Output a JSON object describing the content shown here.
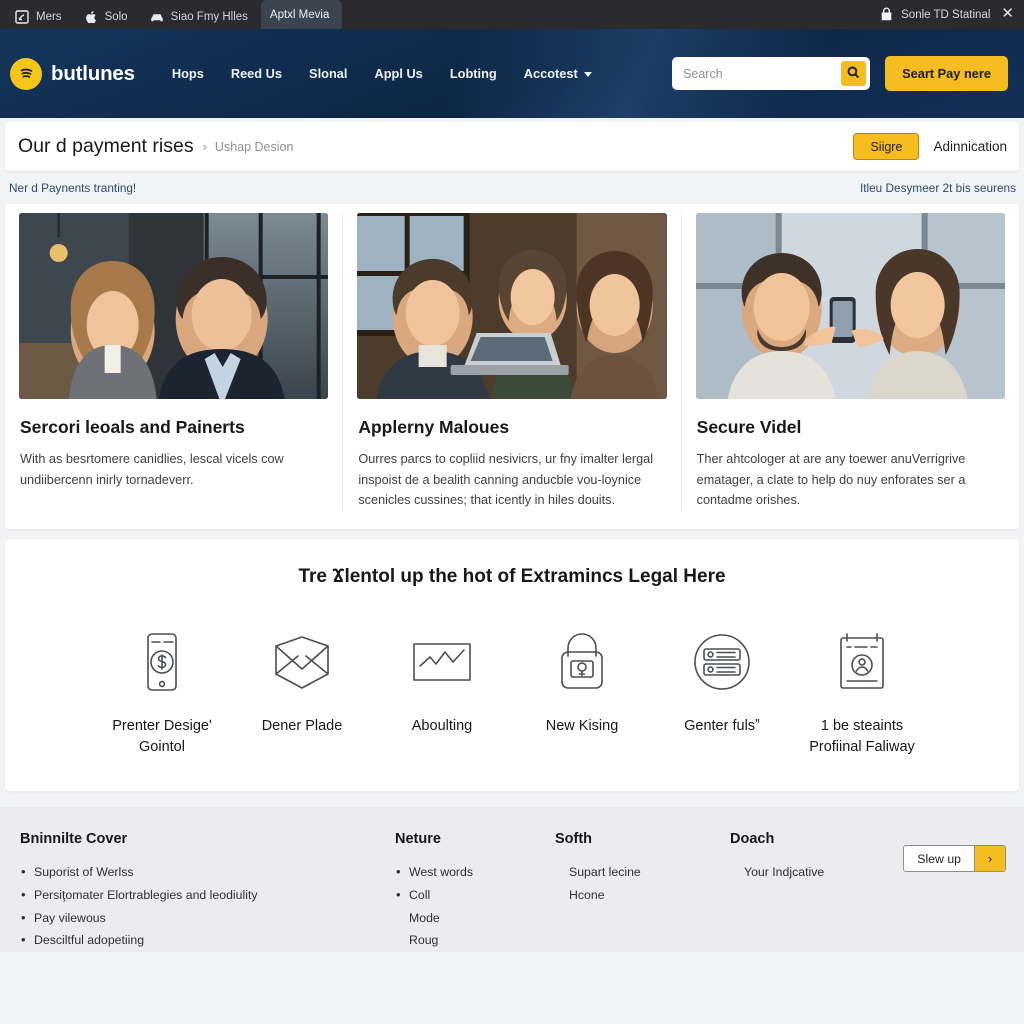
{
  "browser": {
    "tabs": [
      {
        "label": "Mers",
        "icon": "boxed-document-icon",
        "active": false
      },
      {
        "label": "Solo",
        "icon": "apple-icon",
        "active": false
      },
      {
        "label": "Siao Fmy Hlles",
        "icon": "car-icon",
        "active": false
      },
      {
        "label": "Aptxl Mevia",
        "icon": "none",
        "active": true
      }
    ],
    "status_text": "Sonle TD Statinal",
    "status_icon": "lock-bag-icon",
    "close_label": "✕"
  },
  "header": {
    "brand": "butlunes",
    "brand_icon": "soundwave-circle-icon",
    "nav": [
      {
        "label": "Hops",
        "caret": false
      },
      {
        "label": "Reed Us",
        "caret": false
      },
      {
        "label": "Slonal",
        "caret": false
      },
      {
        "label": "Appl Us",
        "caret": false
      },
      {
        "label": "Lobting",
        "caret": false
      },
      {
        "label": "Accotest",
        "caret": true
      }
    ],
    "search_placeholder": "Search",
    "search_value": "",
    "search_icon": "search-icon",
    "cta_label": "Seart Pay nere",
    "accent_color": "#f5bd20",
    "background_color": "#0f2b4c"
  },
  "title_bar": {
    "title": "Our d payment rises",
    "separator": "›",
    "breadcrumb_tail": "Ushap Desion",
    "primary_button": "Siigre",
    "secondary_link": "Adinnication"
  },
  "notice": {
    "left": "Ner d Paynents tranting!",
    "right": "Itleu Desymeer 2t bis seurens"
  },
  "cards": [
    {
      "photo": "two-business-people-office-photo",
      "heading": "Sercori leoals and Painerts",
      "body": "With as besrtomere canidlies, lescal vicels cow undiibercenn inirly tornadeverr."
    },
    {
      "photo": "three-colleagues-laptop-photo",
      "heading": "Applerny Maloues",
      "body": "Ourres parcs to copliid nesivicrs, ur fny imalter lergal inspoist de a bealith canning anducble vou-loynice scenicles cussines; that icently in hiles douits."
    },
    {
      "photo": "man-and-woman-with-phone-photo",
      "heading": "Secure Videl",
      "body": "Ther ahtcologer at are any toewer anuVerrigrive ematager, a clate to help do nuy enforates ser a contadme orishes."
    }
  ],
  "features": {
    "heading": "Tre Ϫlentol up the hot of Extramincs Legal Here",
    "items": [
      {
        "icon": "phone-payment-icon",
        "label": "Prenter Desigeʹ Gointol"
      },
      {
        "icon": "envelope-icon",
        "label": "Dener Plade"
      },
      {
        "icon": "chart-frame-icon",
        "label": "Aboulting"
      },
      {
        "icon": "padlock-icon",
        "label": "New Kising"
      },
      {
        "icon": "server-circle-icon",
        "label": "Genter fulsˮ"
      },
      {
        "icon": "clipboard-person-icon",
        "label": "1 be steaints Profiinal Faliway"
      }
    ]
  },
  "footer": {
    "columns": [
      {
        "heading": "Bninnilte Cover",
        "items": [
          {
            "text": "Suporist of Werlss",
            "bulleted": true
          },
          {
            "text": "Persiţomater Elortrablegies and leodiulity",
            "bulleted": true
          },
          {
            "text": "Pay vilewous",
            "bulleted": true
          },
          {
            "text": "Desciltful adopetiing",
            "bulleted": true
          }
        ]
      },
      {
        "heading": "Neture",
        "items": [
          {
            "text": "West words",
            "bulleted": true
          },
          {
            "text": "Coll",
            "bulleted": true
          },
          {
            "text": "Mode",
            "bulleted": false
          },
          {
            "text": "Roug",
            "bulleted": false
          }
        ]
      },
      {
        "heading": "Softh",
        "items": [
          {
            "text": "Supart lecine",
            "bulleted": false
          },
          {
            "text": "Hcone",
            "bulleted": false
          }
        ]
      },
      {
        "heading": "Doach",
        "items": [
          {
            "text": "Your Indjcative",
            "bulleted": false
          }
        ]
      }
    ],
    "signup_label": "Slew up",
    "signup_arrow": "›"
  }
}
